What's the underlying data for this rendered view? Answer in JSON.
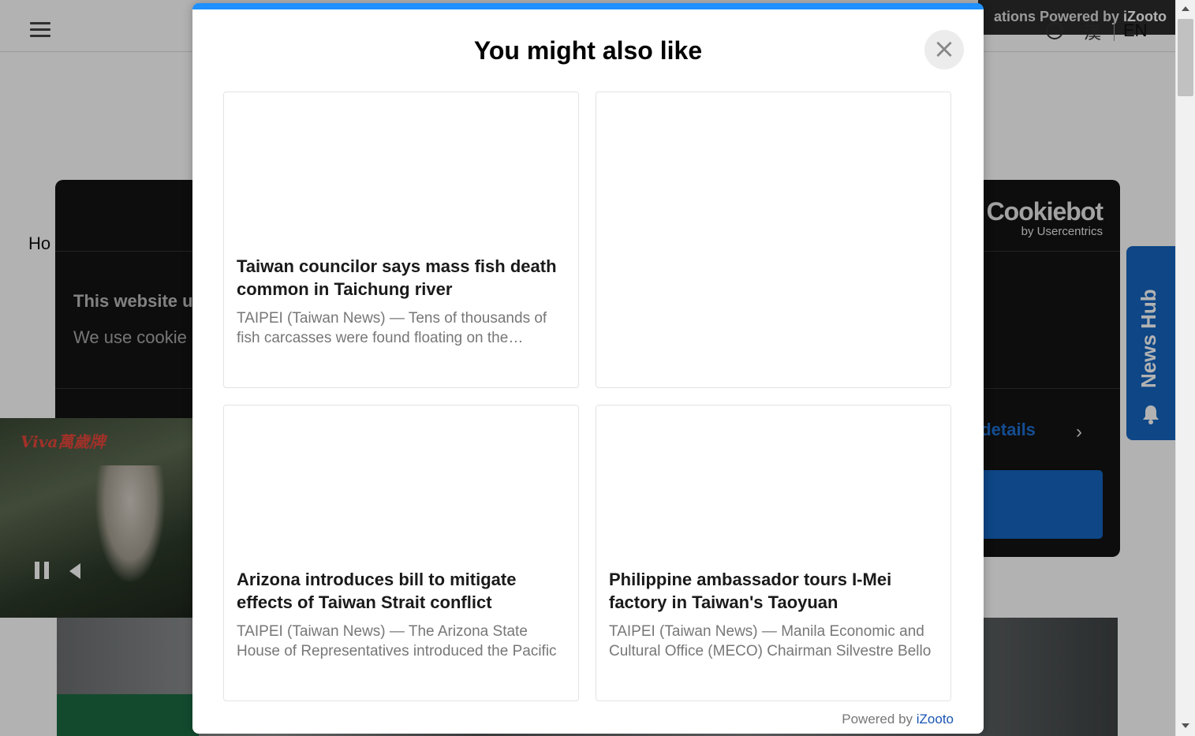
{
  "background": {
    "promo_text": "ations Powered by ",
    "promo_brand": "iZooto",
    "han_label": "漢",
    "lang_label": "EN",
    "home_crumb": "Ho",
    "cookie": {
      "brand_name": "Cookiebot",
      "brand_sub": "by Usercentrics",
      "heading": "This website u",
      "text": "We use cookie",
      "details_link": "w details"
    },
    "news_hub_label": "News Hub",
    "video_logo": "Viva萬歲牌"
  },
  "modal": {
    "title": "You might also like",
    "close_label": "×",
    "cards": [
      {
        "title": "Taiwan councilor says mass fish death common in Taichung river",
        "description": "TAIPEI (Taiwan News) — Tens of thousands of fish carcasses were found floating on the Taichung river"
      },
      {
        "title": "",
        "description": ""
      },
      {
        "title": "Arizona introduces bill to mitigate effects of Taiwan Strait conflict",
        "description": "TAIPEI (Taiwan News) — The Arizona State House of Representatives introduced the Pacific"
      },
      {
        "title": "Philippine ambassador tours I-Mei factory in Taiwan's Taoyuan",
        "description": "TAIPEI (Taiwan News) — Manila Economic and Cultural Office (MECO) Chairman Silvestre Bello"
      }
    ],
    "powered_by": "Powered by ",
    "powered_link": "iZooto"
  },
  "colors": {
    "accent": "#1e90ff",
    "cookie_bg": "#141414",
    "news_hub": "#1565c0"
  }
}
